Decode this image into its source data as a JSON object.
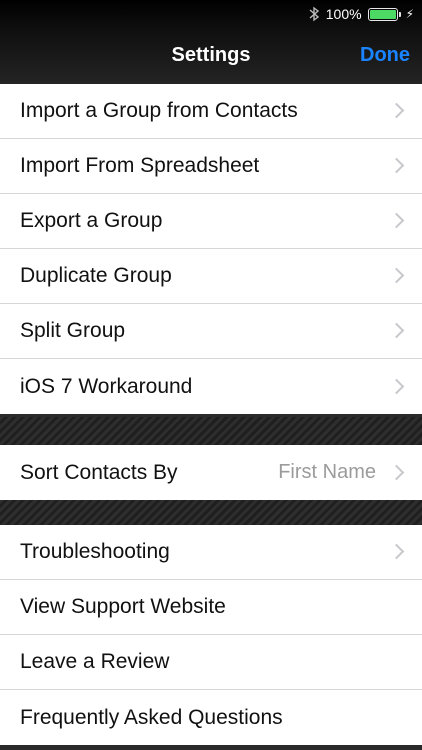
{
  "status_bar": {
    "battery_percent_label": "100%",
    "battery_level": 1.0,
    "icons": [
      "bluetooth-icon",
      "battery-icon",
      "charging-bolt-icon"
    ]
  },
  "nav": {
    "title": "Settings",
    "done_label": "Done",
    "accent_color": "#1a83ff"
  },
  "group1": {
    "items": [
      {
        "label": "Import a Group from Contacts",
        "chevron": true
      },
      {
        "label": "Import From Spreadsheet",
        "chevron": true
      },
      {
        "label": "Export a Group",
        "chevron": true
      },
      {
        "label": "Duplicate Group",
        "chevron": true
      },
      {
        "label": "Split Group",
        "chevron": true
      },
      {
        "label": "iOS 7 Workaround",
        "chevron": true
      }
    ]
  },
  "group2": {
    "items": [
      {
        "label": "Sort Contacts By",
        "value": "First Name",
        "chevron": true
      }
    ]
  },
  "group3": {
    "items": [
      {
        "label": "Troubleshooting",
        "chevron": true
      },
      {
        "label": "View Support Website",
        "chevron": false
      },
      {
        "label": "Leave a Review",
        "chevron": false
      },
      {
        "label": "Frequently Asked Questions",
        "chevron": false
      }
    ]
  }
}
